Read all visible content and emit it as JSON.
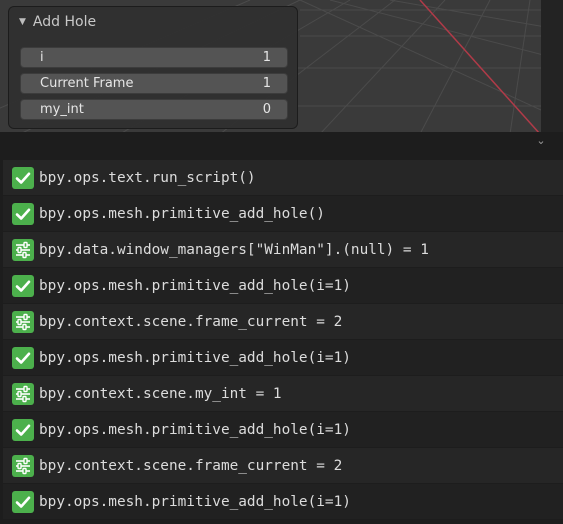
{
  "redo_panel": {
    "title": "Add Hole",
    "properties": [
      {
        "label": "i",
        "value": "1"
      },
      {
        "label": "Current Frame",
        "value": "1"
      },
      {
        "label": "my_int",
        "value": "0"
      }
    ]
  },
  "info_log": {
    "entries": [
      {
        "type": "operator",
        "icon": "checkmark-icon",
        "text": "bpy.ops.text.run_script()"
      },
      {
        "type": "operator",
        "icon": "checkmark-icon",
        "text": "bpy.ops.mesh.primitive_add_hole()"
      },
      {
        "type": "property",
        "icon": "sliders-icon",
        "text": "bpy.data.window_managers[\"WinMan\"].(null) = 1"
      },
      {
        "type": "operator",
        "icon": "checkmark-icon",
        "text": "bpy.ops.mesh.primitive_add_hole(i=1)"
      },
      {
        "type": "property",
        "icon": "sliders-icon",
        "text": "bpy.context.scene.frame_current = 2"
      },
      {
        "type": "operator",
        "icon": "checkmark-icon",
        "text": "bpy.ops.mesh.primitive_add_hole(i=1)"
      },
      {
        "type": "property",
        "icon": "sliders-icon",
        "text": "bpy.context.scene.my_int = 1"
      },
      {
        "type": "operator",
        "icon": "checkmark-icon",
        "text": "bpy.ops.mesh.primitive_add_hole(i=1)"
      },
      {
        "type": "property",
        "icon": "sliders-icon",
        "text": "bpy.context.scene.frame_current = 2"
      },
      {
        "type": "operator",
        "icon": "checkmark-icon",
        "text": "bpy.ops.mesh.primitive_add_hole(i=1)"
      }
    ]
  },
  "colors": {
    "icon_green": "#4cb04c",
    "axis_red": "#b03a48",
    "grid": "#4a4a4a"
  }
}
